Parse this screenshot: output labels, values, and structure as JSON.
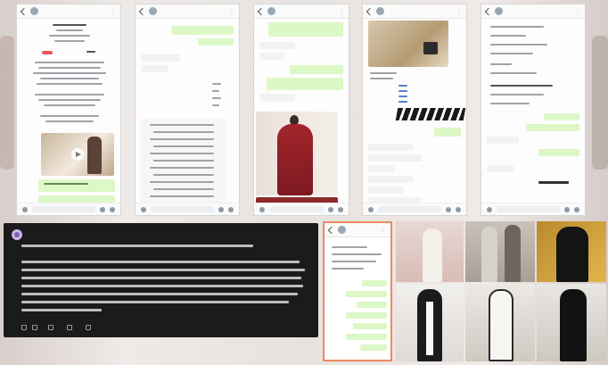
{
  "phones": [
    {
      "id": 1,
      "title": "",
      "price_label": ""
    },
    {
      "id": 2,
      "title": ""
    },
    {
      "id": 3,
      "title": ""
    },
    {
      "id": 4,
      "title": ""
    },
    {
      "id": 5,
      "title": "",
      "price_label": ""
    }
  ],
  "comment": {
    "username": "",
    "time": "",
    "actions": [
      "",
      "",
      "",
      ""
    ]
  },
  "colors": {
    "outgoing_bubble": "#dcf8c6",
    "highlight_border": "#ea8a62",
    "comment_bg": "#1b1b1b",
    "avatar": "#c8b6e6"
  },
  "icons": [
    "back-arrow-icon",
    "more-options-icon",
    "emoji-icon",
    "attachment-icon",
    "camera-icon",
    "upvote-icon",
    "downvote-icon",
    "reply-icon",
    "share-icon",
    "award-icon",
    "play-icon"
  ]
}
